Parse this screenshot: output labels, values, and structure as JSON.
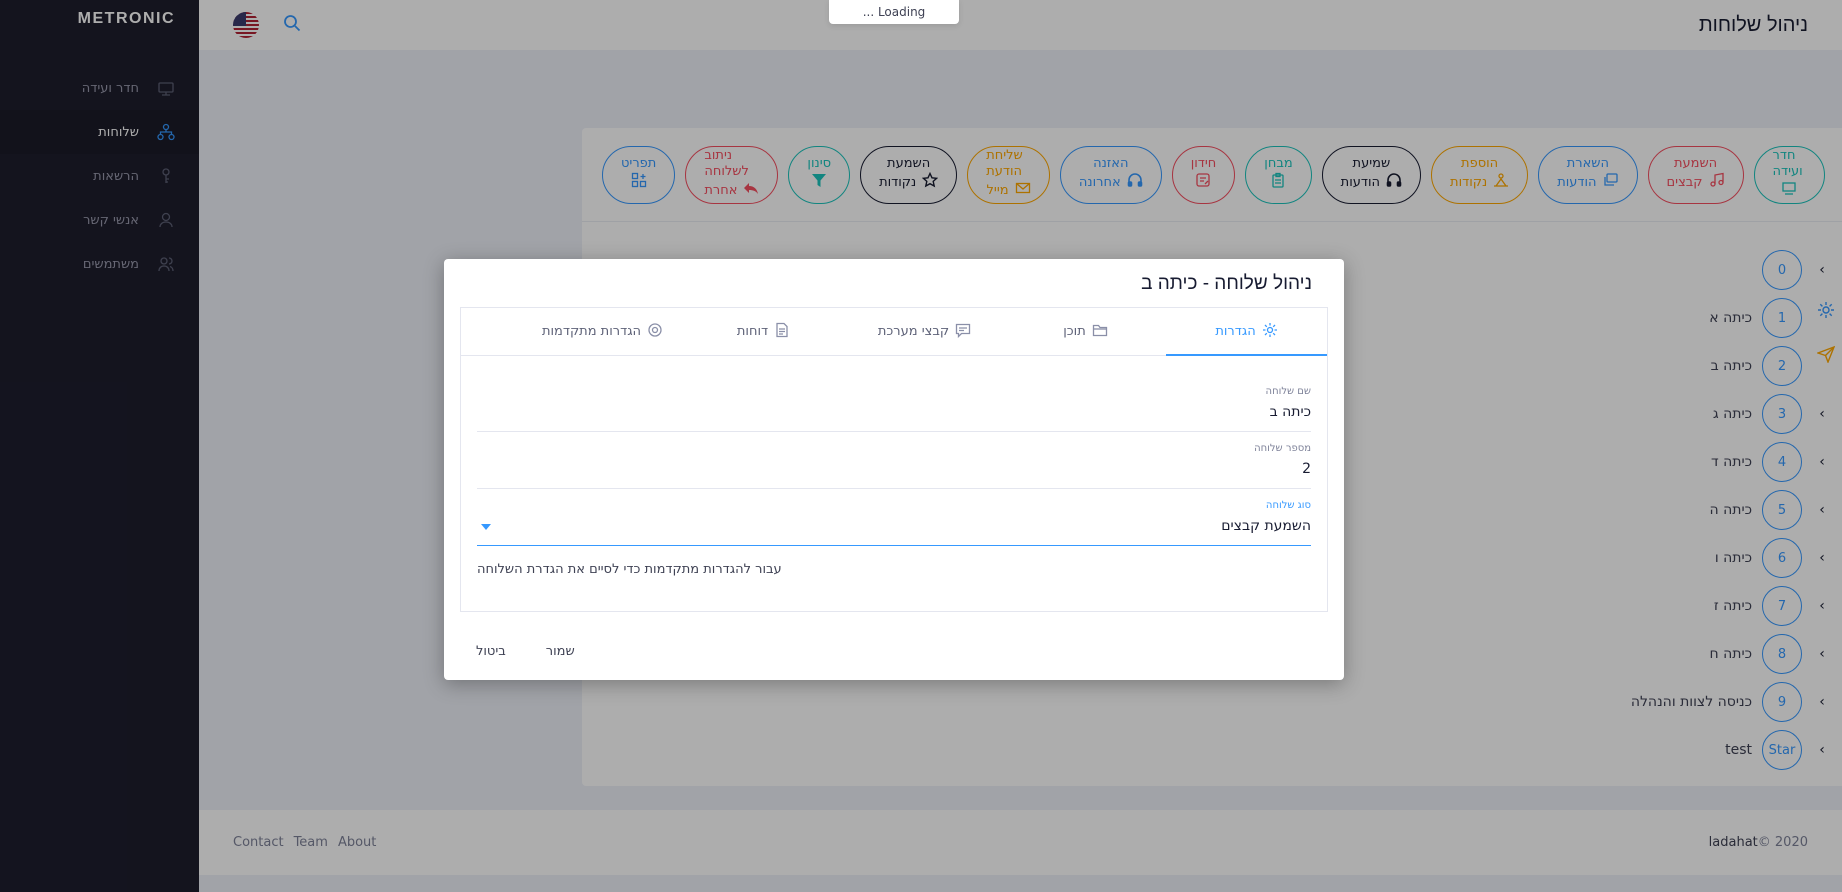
{
  "brand": "METRONIC",
  "sidebar": {
    "items": [
      {
        "label": "חדר ועידה",
        "icon": "conference-icon",
        "active": false
      },
      {
        "label": "שלוחות",
        "icon": "sitemap-icon",
        "active": true
      },
      {
        "label": "הרשאות",
        "icon": "key-icon",
        "active": false
      },
      {
        "label": "אנשי קשר",
        "icon": "contact-icon",
        "active": false
      },
      {
        "label": "משתמשים",
        "icon": "users-icon",
        "active": false
      }
    ]
  },
  "header": {
    "title": "ניהול שלוחות",
    "language": "English (US)",
    "loading_text": "... Loading"
  },
  "toolbar": {
    "buttons": [
      {
        "line1": "חדר ועידה",
        "line2": "",
        "icon": "conference-icon",
        "color": "#1bc5bd"
      },
      {
        "line1": "השמעת",
        "line2": "קבצים",
        "icon": "music-icon",
        "color": "#f64e60"
      },
      {
        "line1": "השארת",
        "line2": "הודעות",
        "icon": "messages-icon",
        "color": "#3699ff"
      },
      {
        "line1": "הוספת",
        "line2": "נקודות",
        "icon": "points-icon",
        "color": "#ffa800"
      },
      {
        "line1": "שמיעת",
        "line2": "הודעות",
        "icon": "headphones-icon",
        "color": "#181c32"
      },
      {
        "line1": "מבחן",
        "line2": "",
        "icon": "clipboard-icon",
        "color": "#1bc5bd"
      },
      {
        "line1": "חידון",
        "line2": "",
        "icon": "quiz-icon",
        "color": "#f64e60"
      },
      {
        "line1": "האזנה",
        "line2": "אחרונה",
        "icon": "headphones-icon",
        "color": "#3699ff"
      },
      {
        "line1": "שליחת הודעת",
        "line2": "מייל",
        "icon": "mail-icon",
        "color": "#ffa800"
      },
      {
        "line1": "השמעת",
        "line2": "נקודות",
        "icon": "star-icon",
        "color": "#181c32"
      },
      {
        "line1": "סינון",
        "line2": "",
        "icon": "filter-icon",
        "color": "#1bc5bd"
      },
      {
        "line1": "ניתוב לשלוחה",
        "line2": "אחרת",
        "icon": "reply-icon",
        "color": "#f64e60"
      },
      {
        "line1": "תפריט",
        "line2": "",
        "icon": "menu-grid-icon",
        "color": "#3699ff"
      }
    ]
  },
  "tree": {
    "rows": [
      {
        "num": "0",
        "label": ""
      },
      {
        "num": "1",
        "label": "כיתה א"
      },
      {
        "num": "2",
        "label": "כיתה ב"
      },
      {
        "num": "3",
        "label": "כיתה ג"
      },
      {
        "num": "4",
        "label": "כיתה ד"
      },
      {
        "num": "5",
        "label": "כיתה ה"
      },
      {
        "num": "6",
        "label": "כיתה ו"
      },
      {
        "num": "7",
        "label": "כיתה ז"
      },
      {
        "num": "8",
        "label": "כיתה ח"
      },
      {
        "num": "9",
        "label": "כניסה לצוות והנהלה"
      },
      {
        "num": "Star",
        "label": "test"
      }
    ]
  },
  "footer": {
    "links": [
      "Contact",
      "Team",
      "About"
    ],
    "copyright": "© 2020",
    "brand": "ladahat"
  },
  "modal": {
    "title": "ניהול שלוחה - כיתה ב",
    "tabs": [
      {
        "label": "הגדרות",
        "icon": "gear-icon",
        "active": true
      },
      {
        "label": "תוכן",
        "icon": "folder-icon",
        "active": false
      },
      {
        "label": "קבצי מערכת",
        "icon": "comment-icon",
        "active": false
      },
      {
        "label": "דוחות",
        "icon": "document-icon",
        "active": false
      },
      {
        "label": "הגדרות מתקדמות",
        "icon": "gear-advanced-icon",
        "active": false
      }
    ],
    "fields": {
      "name_label": "שם שלוחה",
      "name_value": "כיתה ב",
      "number_label": "מספר שלוחה",
      "number_value": "2",
      "type_label": "סוג שלוחה",
      "type_value": "השמעת קבצים"
    },
    "hint": "עבור להגדרות מתקדמות כדי לסיים את הגדרת השלוחה",
    "save_label": "שמור",
    "cancel_label": "ביטול"
  }
}
